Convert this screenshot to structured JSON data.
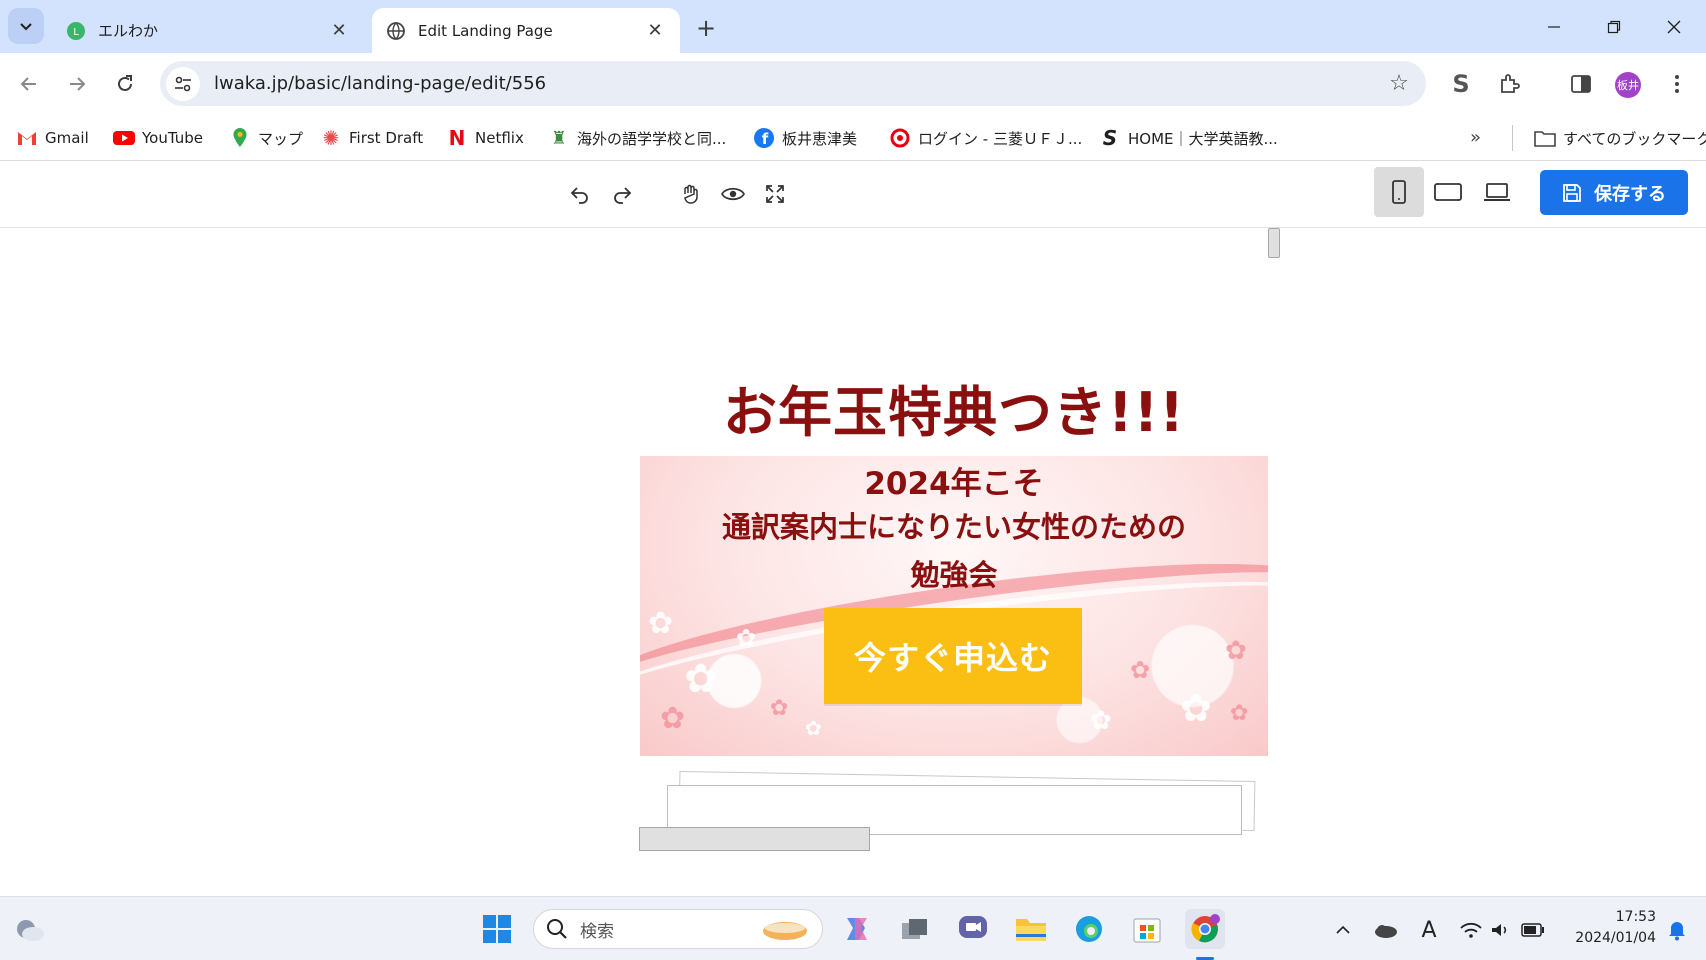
{
  "browser": {
    "tabs": [
      {
        "title": "エルわか",
        "active": false
      },
      {
        "title": "Edit Landing Page",
        "active": true
      }
    ],
    "url": "lwaka.jp/basic/landing-page/edit/556",
    "avatar_label": "板井"
  },
  "bookmarks": {
    "items": [
      {
        "label": "Gmail",
        "icon": "gmail-icon"
      },
      {
        "label": "YouTube",
        "icon": "youtube-icon"
      },
      {
        "label": "マップ",
        "icon": "maps-icon"
      },
      {
        "label": "First Draft",
        "icon": "first-draft-icon"
      },
      {
        "label": "Netflix",
        "icon": "netflix-icon"
      },
      {
        "label": "海外の語学学校と同...",
        "icon": "school-icon"
      },
      {
        "label": "板井恵津美",
        "icon": "facebook-icon"
      },
      {
        "label": "ログイン - 三菱ＵＦＪ...",
        "icon": "mufg-icon"
      },
      {
        "label": "HOME｜大学英語教...",
        "icon": "home-s-icon"
      }
    ],
    "all_bookmarks_label": "すべてのブックマーク"
  },
  "editor": {
    "save_label": "保存する",
    "selected_device": "mobile"
  },
  "landing_page": {
    "headline": "お年玉特典つき!!!",
    "subline1": "2024年こそ",
    "subline2": "通訳案内士になりたい女性のための",
    "subline3": "勉強会",
    "cta_label": "今すぐ申込む",
    "colors": {
      "headline": "#8a0f0f",
      "cta": "#fbbf14",
      "save": "#1a73e8"
    }
  },
  "taskbar": {
    "search_placeholder": "検索",
    "time": "17:53",
    "date": "2024/01/04"
  }
}
